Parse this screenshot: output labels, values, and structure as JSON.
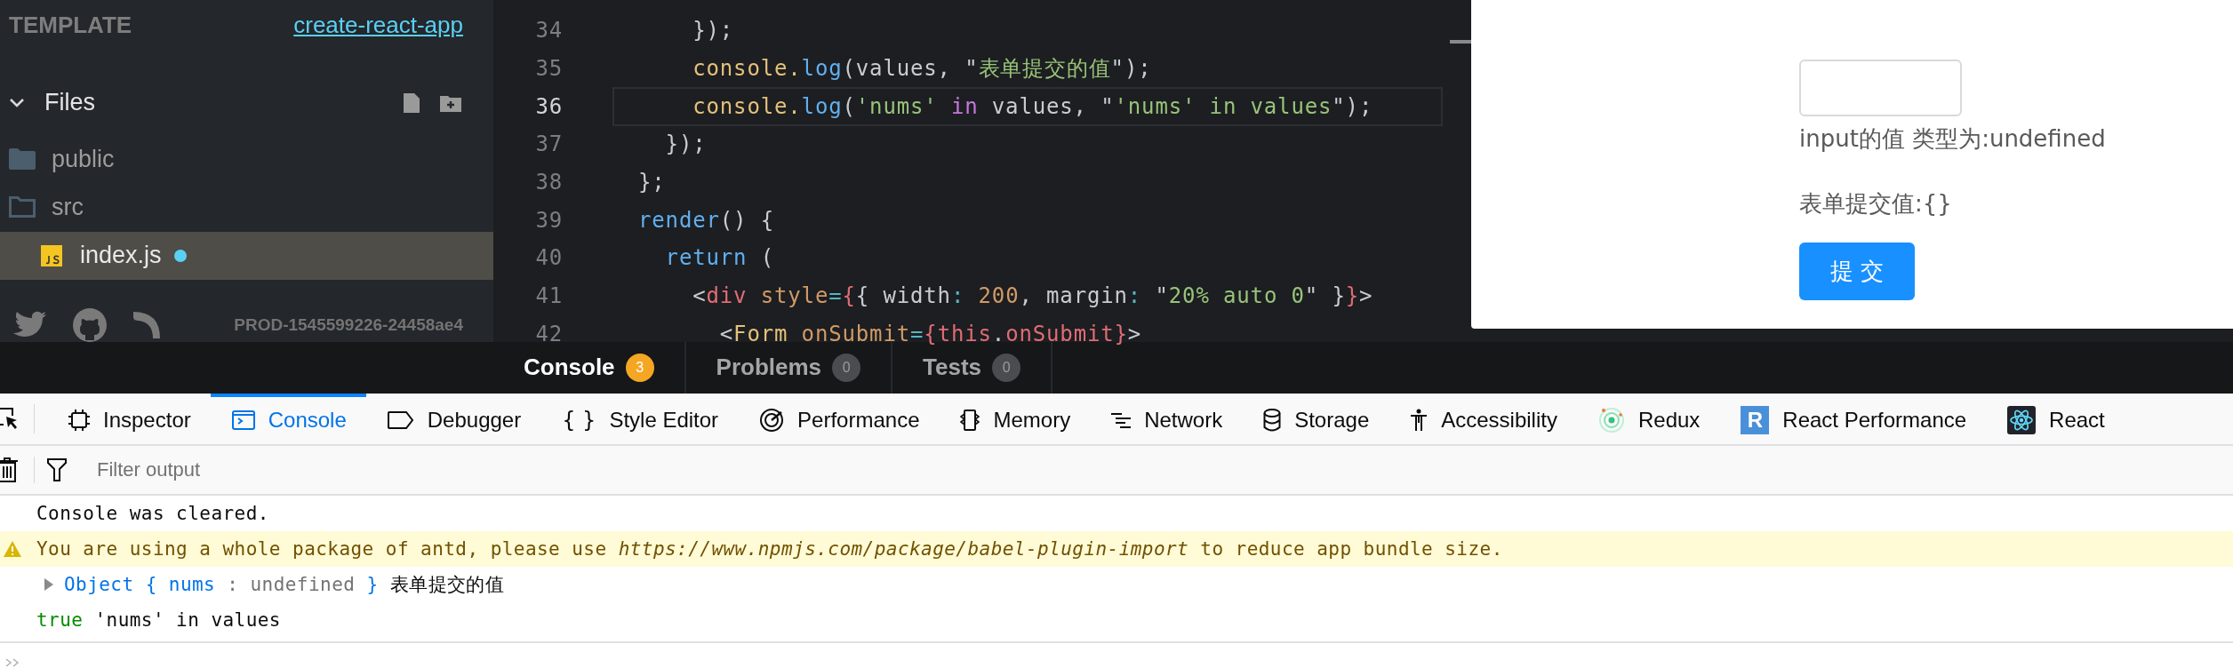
{
  "sidebar": {
    "template_label": "TEMPLATE",
    "template_link": "create-react-app",
    "files_header": {
      "label": "Files",
      "expanded": true
    },
    "files": [
      {
        "name": "public",
        "kind": "folder",
        "expanded": false,
        "selected": false
      },
      {
        "name": "src",
        "kind": "folder",
        "expanded": true,
        "selected": false,
        "children": [
          {
            "name": "index.js",
            "kind": "js",
            "selected": true,
            "modified": true
          }
        ]
      }
    ],
    "version": "PROD-1545599226-24458ae4"
  },
  "editor": {
    "lines": [
      {
        "number": "34",
        "current": false,
        "tokens": [
          {
            "kind": "plain",
            "text": "    });"
          }
        ]
      },
      {
        "number": "35",
        "current": false,
        "tokens": [
          {
            "kind": "obj",
            "text": "    console."
          },
          {
            "kind": "fn",
            "text": "log"
          },
          {
            "kind": "plain",
            "text": "(values, \""
          },
          {
            "kind": "str",
            "text": "表单提交的值"
          },
          {
            "kind": "plain",
            "text": "\");"
          }
        ]
      },
      {
        "number": "36",
        "current": true,
        "tokens": [
          {
            "kind": "obj",
            "text": "    console."
          },
          {
            "kind": "fn",
            "text": "log"
          },
          {
            "kind": "plain",
            "text": "("
          },
          {
            "kind": "str",
            "text": "'nums'"
          },
          {
            "kind": "kw",
            "text": " in"
          },
          {
            "kind": "plain",
            "text": " values, \""
          },
          {
            "kind": "str",
            "text": "'nums' in values"
          },
          {
            "kind": "plain",
            "text": "\");"
          }
        ]
      },
      {
        "number": "37",
        "current": false,
        "tokens": [
          {
            "kind": "plain",
            "text": "  });"
          }
        ]
      },
      {
        "number": "38",
        "current": false,
        "tokens": [
          {
            "kind": "plain",
            "text": "};"
          }
        ]
      },
      {
        "number": "39",
        "current": false,
        "tokens": [
          {
            "kind": "fn",
            "text": "render"
          },
          {
            "kind": "plain",
            "text": "() {"
          }
        ]
      },
      {
        "number": "40",
        "current": false,
        "tokens": [
          {
            "kind": "fn",
            "text": "  return"
          },
          {
            "kind": "plain",
            "text": " ("
          }
        ]
      },
      {
        "number": "41",
        "current": false,
        "tokens": [
          {
            "kind": "plain",
            "text": "    <"
          },
          {
            "kind": "tag",
            "text": "div"
          },
          {
            "kind": "attr",
            "text": " style"
          },
          {
            "kind": "punct",
            "text": "="
          },
          {
            "kind": "tag",
            "text": "{"
          },
          {
            "kind": "plain",
            "text": "{ width"
          },
          {
            "kind": "punct",
            "text": ":"
          },
          {
            "kind": "num",
            "text": " 200"
          },
          {
            "kind": "plain",
            "text": ", margin"
          },
          {
            "kind": "punct",
            "text": ":"
          },
          {
            "kind": "plain",
            "text": " \""
          },
          {
            "kind": "str",
            "text": "20% auto 0"
          },
          {
            "kind": "plain",
            "text": "\" }"
          },
          {
            "kind": "tag",
            "text": "}"
          },
          {
            "kind": "plain",
            "text": ">"
          }
        ]
      },
      {
        "number": "42",
        "current": false,
        "tokens": [
          {
            "kind": "plain",
            "text": "      <"
          },
          {
            "kind": "obj",
            "text": "Form"
          },
          {
            "kind": "attr",
            "text": " onSubmit"
          },
          {
            "kind": "punct",
            "text": "="
          },
          {
            "kind": "tag",
            "text": "{this"
          },
          {
            "kind": "plain",
            "text": "."
          },
          {
            "kind": "tag",
            "text": "onSubmit}"
          },
          {
            "kind": "plain",
            "text": ">"
          }
        ]
      }
    ]
  },
  "preview": {
    "input_label": "input的值 类型为:undefined",
    "result": "表单提交值:{}",
    "submit_button": "提 交"
  },
  "bottom_tabs": [
    {
      "label": "Console",
      "count": "3",
      "selected": true,
      "color": "#f5a623"
    },
    {
      "label": "Problems",
      "count": "0",
      "selected": false,
      "color": "#4a4c50"
    },
    {
      "label": "Tests",
      "count": "0",
      "selected": false,
      "color": "#4a4c50"
    }
  ],
  "devtools": {
    "tools": [
      {
        "kind": "inspector",
        "label": "Inspector",
        "selected": false
      },
      {
        "kind": "console",
        "label": "Console",
        "selected": true
      },
      {
        "kind": "debugger",
        "label": "Debugger",
        "selected": false
      },
      {
        "kind": "style-editor",
        "label": "Style Editor",
        "selected": false,
        "icon_text": "{ }"
      },
      {
        "kind": "performance",
        "label": "Performance",
        "selected": false
      },
      {
        "kind": "memory",
        "label": "Memory",
        "selected": false
      },
      {
        "kind": "network",
        "label": "Network",
        "selected": false
      },
      {
        "kind": "storage",
        "label": "Storage",
        "selected": false
      },
      {
        "kind": "accessibility",
        "label": "Accessibility",
        "selected": false
      },
      {
        "kind": "redux",
        "label": "Redux",
        "selected": false
      },
      {
        "kind": "react-performance",
        "label": "React Performance",
        "selected": false,
        "icon_text": "R"
      },
      {
        "kind": "react",
        "label": "React",
        "selected": false
      }
    ],
    "filter": {
      "placeholder": "Filter output"
    },
    "messages": [
      {
        "kind": "info",
        "text": "Console was cleared."
      },
      {
        "kind": "warning",
        "text": "You are using a whole package of antd, please use *https://www.npmjs.com/package/babel-plugin-import* to reduce app bundle size."
      },
      {
        "kind": "object",
        "expanded": false,
        "tokens": [
          {
            "kind": "obj",
            "text": "Object"
          },
          {
            "kind": "obj",
            "text": "{"
          },
          {
            "kind": "obj",
            "text": "nums"
          },
          {
            "kind": "dim",
            "text": ":"
          },
          {
            "kind": "dim",
            "text": "undefined"
          },
          {
            "kind": "obj",
            "text": "}"
          },
          {
            "kind": "plain",
            "text": "表单提交的值"
          }
        ]
      },
      {
        "kind": "log",
        "tokens": [
          {
            "kind": "bool",
            "text": "true"
          },
          {
            "kind": "plain",
            "text": "'nums' in values"
          }
        ]
      }
    ]
  }
}
